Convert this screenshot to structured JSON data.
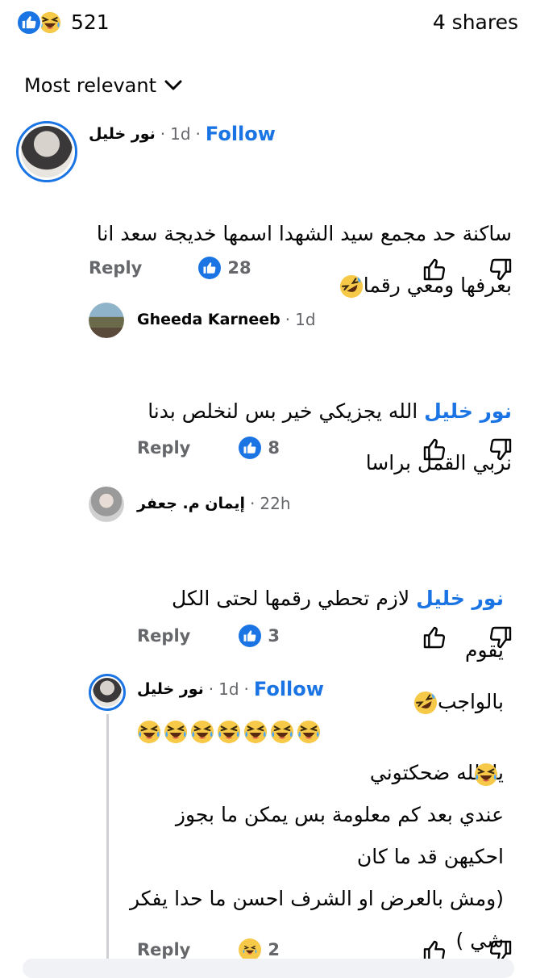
{
  "header": {
    "reaction_count": "521",
    "shares": "4 shares",
    "reaction_types": [
      "like",
      "haha"
    ]
  },
  "sort": {
    "label": "Most relevant",
    "icon": "chevron-down-icon"
  },
  "comments": [
    {
      "author": "نور خليل",
      "time": "1d",
      "follow": "Follow",
      "text": "ساكنة حد مجمع سيد الشهدا اسمها خديجة سعد انا\nبعرفها ومعي رقما",
      "reply": "Reply",
      "likes": "28"
    },
    {
      "author": "Gheeda Karneeb",
      "time": "1d",
      "mention": "نور خليل",
      "text": "الله يجزيكي خير بس لنخلص  بدنا\nنربي القمل براسا",
      "reply": "Reply",
      "likes": "8"
    },
    {
      "author": "إيمان م. جعفر",
      "time": "22h",
      "mention": "نور خليل",
      "text": "لازم تحطي رقمها لحتى الكل يقوم\nبالواجب",
      "reply": "Reply",
      "likes": "3"
    },
    {
      "author": "نور خليل",
      "time": "1d",
      "follow": "Follow",
      "text": "يا الله ضحكتوني\nعندي بعد كم معلومة بس يمكن ما بجوز\nاحكيهن قد ما كان \n(ومش بالعرض او الشرف احسن ما حدا يفكر\nشي )",
      "reply": "Reply",
      "likes": "2"
    }
  ],
  "colors": {
    "accent": "#1b74e4",
    "muted": "#65676b"
  }
}
